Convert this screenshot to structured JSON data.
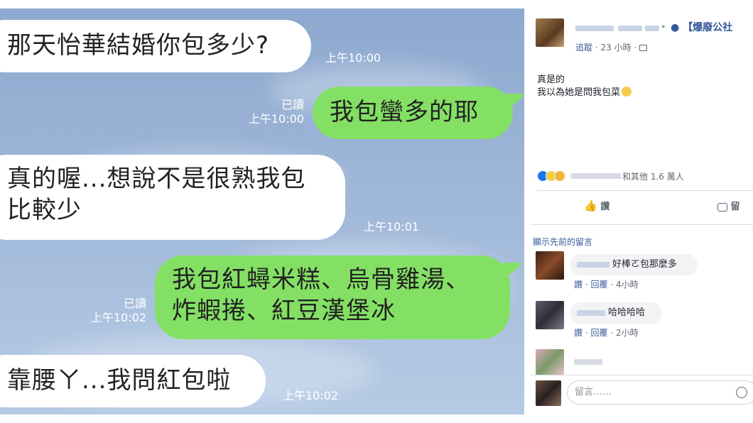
{
  "chat": {
    "messages": [
      {
        "text": "那天怡華結婚你包多少?",
        "time": "上午10:00"
      },
      {
        "text": "我包蠻多的耶",
        "read": "已讀",
        "time": "上午10:00"
      },
      {
        "line1": "真的喔...想說不是很熟我包",
        "line2": "比較少",
        "time": "上午10:01"
      },
      {
        "line1": "我包紅蟳米糕、烏骨雞湯、",
        "line2": "炸蝦捲、紅豆漢堡冰",
        "read": "已讀",
        "time": "上午10:02"
      },
      {
        "text": "靠腰ㄚ...我問紅包啦",
        "time": "上午10:02"
      }
    ]
  },
  "facebook": {
    "post": {
      "arrow": "▸",
      "page_name": "● 【爆廢公社",
      "follow": "追蹤",
      "meta": " · 23 小時 · ",
      "body_line1": "真是的",
      "body_line2": "我以為她是問我包菜",
      "emoji": "😕"
    },
    "reactions": {
      "summary": "和其他 1.6 萬人"
    },
    "actions": {
      "like": "讚",
      "comment": "留"
    },
    "comments_header": "顯示先前的留言",
    "comments": [
      {
        "text": "好棒ㄛ包那麼多",
        "like": "讚",
        "reply": "回覆",
        "time": "4小時"
      },
      {
        "text": "哈哈哈哈",
        "like": "讚",
        "reply": "回覆",
        "time": "2小時"
      }
    ],
    "input_placeholder": "留言……",
    "colors": {
      "line_green": "#84e064",
      "fb_blue": "#365899",
      "like_blue": "#1877f2"
    }
  }
}
